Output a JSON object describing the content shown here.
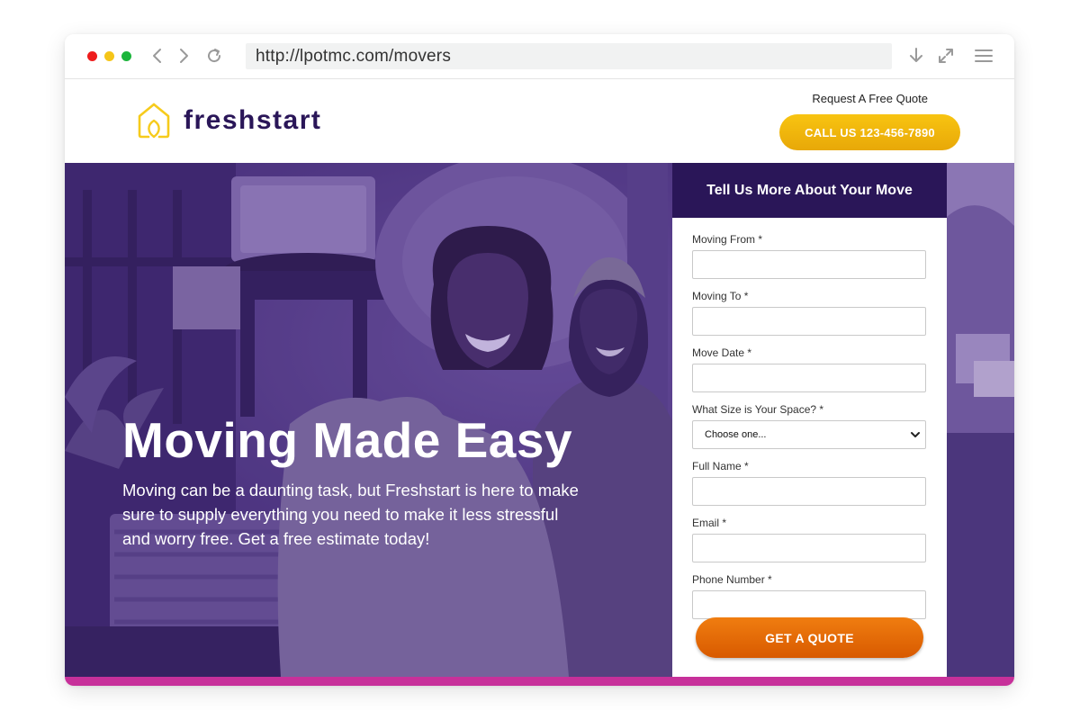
{
  "browser": {
    "url": "http://lpotmc.com/movers",
    "icons": [
      "back-icon",
      "forward-icon",
      "reload-icon",
      "download-icon",
      "expand-icon",
      "menu-icon"
    ]
  },
  "header": {
    "logo_text": "freshstart",
    "request_text": "Request A Free Quote",
    "call_button": "CALL US 123-456-7890"
  },
  "hero": {
    "title": "Moving Made Easy",
    "subtitle": "Moving can be a daunting task, but Freshstart is here to make sure to supply everything you need to make it less stressful and worry free. Get a free estimate today!"
  },
  "form": {
    "title": "Tell Us More About Your Move",
    "fields": {
      "moving_from": "Moving From *",
      "moving_to": "Moving To *",
      "move_date": "Move Date *",
      "space_size": "What Size is Your Space? *",
      "full_name": "Full Name *",
      "email": "Email *",
      "phone": "Phone Number *"
    },
    "space_size_selected": "Choose one...",
    "submit_label": "GET A QUOTE"
  },
  "colors": {
    "brand_dark_purple": "#2a1658",
    "hero_purple": "#4f3785",
    "call_button_yellow": "#f2b80d",
    "quote_button_orange": "#e76b08",
    "accent_magenta": "#c7309a"
  }
}
